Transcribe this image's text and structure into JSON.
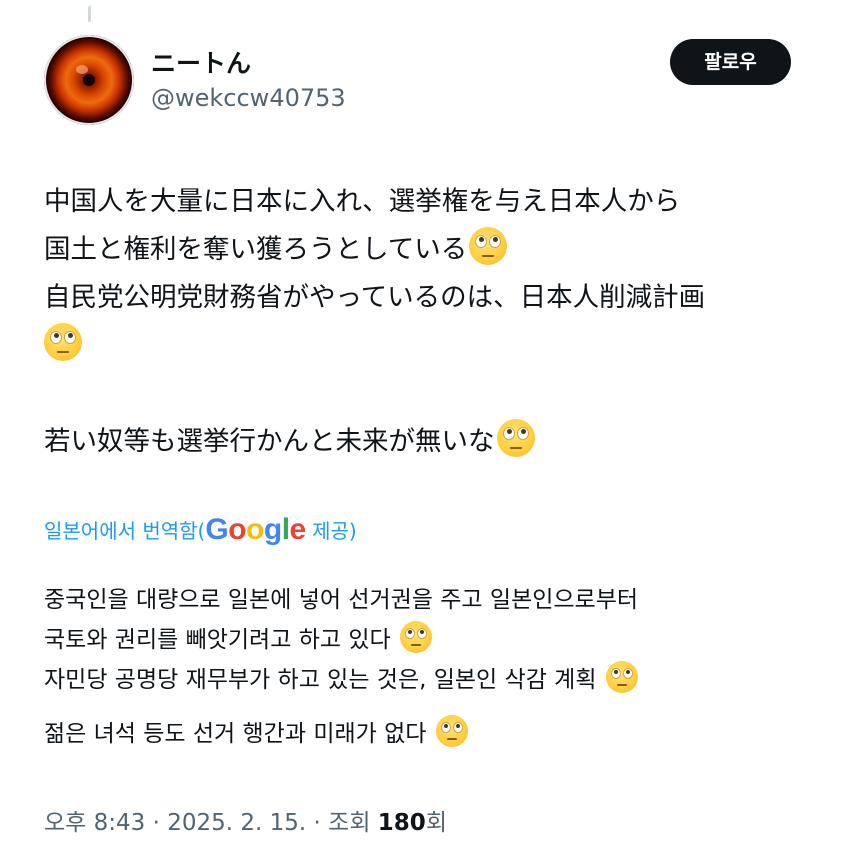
{
  "author": {
    "display_name": "ニートん",
    "handle": "@wekccw40753"
  },
  "follow_label": "팔로우",
  "tweet": {
    "lines": [
      "中国人を大量に日本に入れ、選挙権を与え日本人から",
      "国土と権利を奪い獲ろうとしている",
      "自民党公明党財務省がやっているのは、日本人削減計画",
      "",
      "若い奴等も選挙行かんと未来が無いな"
    ]
  },
  "translation": {
    "label_prefix": "일본어에서 번역함(",
    "google": [
      "G",
      "o",
      "o",
      "g",
      "l",
      "e"
    ],
    "label_suffix": " 제공)",
    "lines": [
      "중국인을 대량으로 일본에 넣어 선거권을 주고 일본인으로부터",
      "국토와 권리를 빼앗기려고 하고 있다",
      "자민당 공명당 재무부가 하고 있는 것은, 일본인 삭감 계획",
      "젊은 녀석 등도 선거 행간과 미래가 없다"
    ]
  },
  "meta": {
    "time": "오후 8:43",
    "separator": " · ",
    "date": "2025. 2. 15.",
    "views_prefix": "조회 ",
    "views_count": "180",
    "views_suffix": "회"
  },
  "icons": {
    "avatar": "red-eye-avatar",
    "emoji": "face-with-rolling-eyes-emoji"
  },
  "colors": {
    "link": "#1d9bf0",
    "secondary_text": "#536471",
    "follow_button_bg": "#0f1419"
  }
}
